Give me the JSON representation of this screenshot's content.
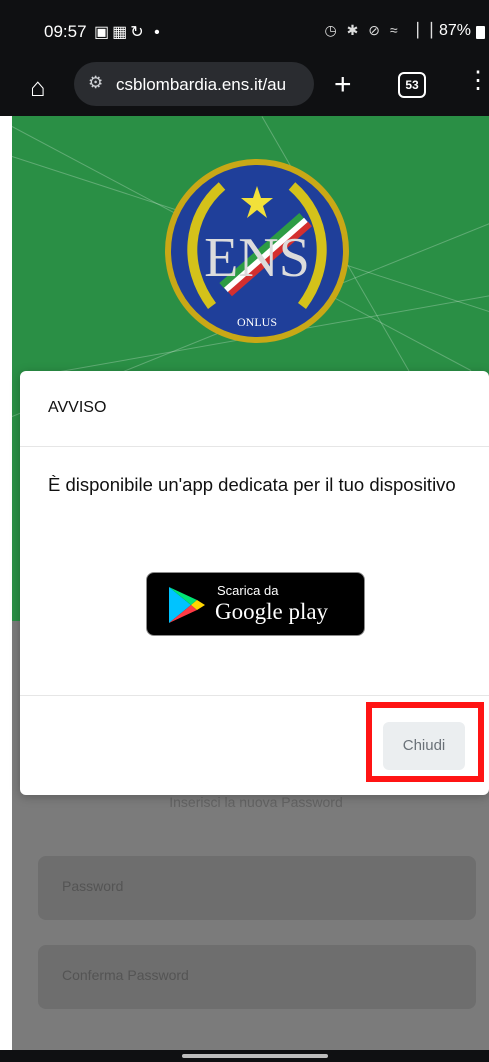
{
  "status_bar": {
    "time": "09:57",
    "left_icons": "▣▦↻ •",
    "right_icons": "◷ ✱ ⊘ ≈ ▕▕",
    "battery": "87%"
  },
  "browser": {
    "url": "csblombardia.ens.it/au",
    "tab_count": "53",
    "icons": [
      "home-icon",
      "site-settings-icon",
      "new-tab-icon",
      "tab-switcher-icon",
      "more-vert-icon"
    ]
  },
  "hero": {
    "background_color": "#2a8f45",
    "logo": {
      "text": "ENS",
      "subtitle": "ONLUS"
    }
  },
  "page": {
    "prompt": "Inserisci la nuova Password",
    "password_placeholder": "Password",
    "confirm_placeholder": "Conferma Password"
  },
  "modal": {
    "title": "AVVISO",
    "message": "È disponibile un'app dedicata per il tuo dispositivo",
    "badge_line1": "Scarica da",
    "badge_line2": "Google play",
    "close_label": "Chiudi"
  },
  "colors": {
    "overlay_text": "#636363",
    "highlight": "#ff1414"
  }
}
